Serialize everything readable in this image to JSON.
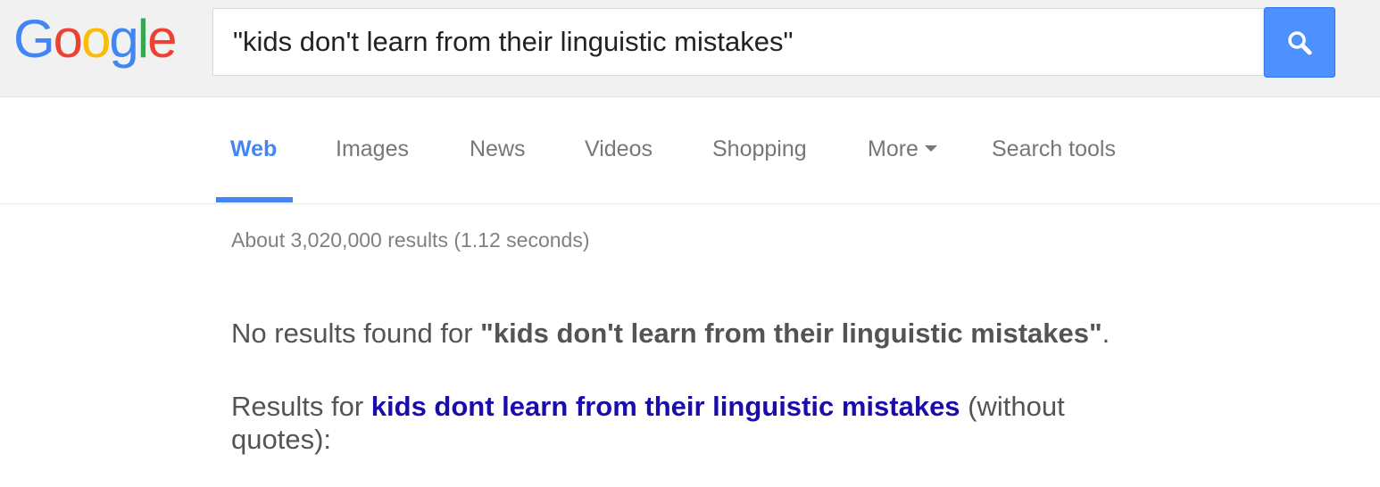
{
  "header": {
    "logo": {
      "letters": [
        "G",
        "o",
        "o",
        "g",
        "l",
        "e"
      ],
      "colors": [
        "#4285f4",
        "#ea4335",
        "#fbbc05",
        "#4285f4",
        "#34a853",
        "#ea4335"
      ]
    },
    "search": {
      "value": "\"kids don't learn from their linguistic mistakes\"",
      "icon": "search-icon"
    }
  },
  "tabs": {
    "web": "Web",
    "images": "Images",
    "news": "News",
    "videos": "Videos",
    "shopping": "Shopping",
    "more": "More",
    "search_tools": "Search tools",
    "active": "Web"
  },
  "results": {
    "stats": "About 3,020,000 results (1.12 seconds)",
    "no_results_prefix": "No results found for ",
    "no_results_query": "\"kids don't learn from their linguistic mistakes\"",
    "no_results_suffix": ".",
    "results_for_prefix": "Results for ",
    "results_for_link": "kids dont learn from their linguistic mistakes",
    "results_for_suffix": " (without quotes):"
  },
  "colors": {
    "accent": "#4285f4",
    "search_button": "#4d90fe",
    "link": "#1a0dab"
  }
}
